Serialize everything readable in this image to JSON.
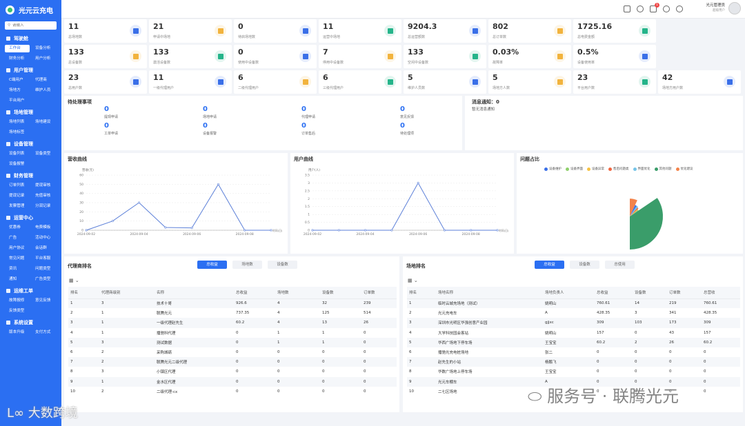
{
  "app": {
    "title": "光元云充电"
  },
  "search": {
    "placeholder": "请输入"
  },
  "sidebar": {
    "groups": [
      {
        "title": "驾驶舱",
        "items": [
          "工作台",
          "设备分析",
          "财务分析",
          "用户分析"
        ]
      },
      {
        "title": "用户管理",
        "items": [
          "C端用户",
          "代理商",
          "场地方",
          "维护人员",
          "平台用户"
        ]
      },
      {
        "title": "场地管理",
        "items": [
          "场地列表",
          "场地建设",
          "场地标签"
        ]
      },
      {
        "title": "设备管理",
        "items": [
          "设备列表",
          "设备类型",
          "设备报警"
        ]
      },
      {
        "title": "财务管理",
        "items": [
          "订单列表",
          "提现审核",
          "提现记录",
          "充值审核",
          "发票管理",
          "分润记录"
        ]
      },
      {
        "title": "运营中心",
        "items": [
          "优惠券",
          "电费模板",
          "广告",
          "活动中心",
          "用户协议",
          "会话群",
          "常见问题",
          "平台客服",
          "资讯",
          "问题类型",
          "通知",
          "广告类型"
        ]
      },
      {
        "title": "运维工单",
        "items": [
          "故障报修",
          "意见反馈",
          "反馈类型"
        ]
      },
      {
        "title": "系统设置",
        "items": [
          "版本升级",
          "支付方式"
        ]
      }
    ]
  },
  "topbar": {
    "notification_count": "1",
    "user_name": "光元管理员",
    "user_role": "超级用户"
  },
  "stats": [
    {
      "value": "11",
      "label": "总场地数",
      "color": "#3a6fe8"
    },
    {
      "value": "21",
      "label": "申请中场地",
      "color": "#f2b33d"
    },
    {
      "value": "0",
      "label": "待启场地数",
      "color": "#3a6fe8"
    },
    {
      "value": "11",
      "label": "运营中场地",
      "color": "#25b48a"
    },
    {
      "value": "9204.3",
      "label": "总运营额数",
      "color": "#3a6fe8"
    },
    {
      "value": "802",
      "label": "总订单数",
      "color": "#f2b33d"
    },
    {
      "value": "1725.16",
      "label": "总电费金额",
      "color": "#25b48a"
    },
    {
      "value": "",
      "label": "",
      "color": "#3a6fe8"
    },
    {
      "value": "133",
      "label": "总设备数",
      "color": "#f2b33d"
    },
    {
      "value": "133",
      "label": "激活设备数",
      "color": "#25b48a"
    },
    {
      "value": "0",
      "label": "使用中设备数",
      "color": "#3a6fe8"
    },
    {
      "value": "7",
      "label": "停用中设备数",
      "color": "#f2b33d"
    },
    {
      "value": "133",
      "label": "空闲中设备数",
      "color": "#25b48a"
    },
    {
      "value": "0.03%",
      "label": "故障率",
      "color": "#f2b33d"
    },
    {
      "value": "0.5%",
      "label": "设备使用率",
      "color": "#3a6fe8"
    },
    {
      "value": "",
      "label": "",
      "color": "#3a6fe8"
    },
    {
      "value": "23",
      "label": "总用户数",
      "color": "#3a6fe8"
    },
    {
      "value": "11",
      "label": "一级代理用户",
      "color": "#3a6fe8"
    },
    {
      "value": "6",
      "label": "二级代理用户",
      "color": "#f2b33d"
    },
    {
      "value": "6",
      "label": "三级代理用户",
      "color": "#25b48a"
    },
    {
      "value": "5",
      "label": "维护人员数",
      "color": "#3a6fe8"
    },
    {
      "value": "5",
      "label": "场地方人数",
      "color": "#f2b33d"
    },
    {
      "value": "23",
      "label": "平台用户数",
      "color": "#25b48a"
    },
    {
      "value": "42",
      "label": "场地方用户数",
      "color": "#3a6fe8"
    }
  ],
  "pending": {
    "title": "待处理事项",
    "items": [
      {
        "value": "0",
        "label": "提现申请"
      },
      {
        "value": "0",
        "label": "场地申请"
      },
      {
        "value": "0",
        "label": "代理申请"
      },
      {
        "value": "0",
        "label": "意见反馈"
      },
      {
        "value": "0",
        "label": "工单申请"
      },
      {
        "value": "0",
        "label": "设备报警"
      },
      {
        "value": "0",
        "label": "订单售后"
      },
      {
        "value": "0",
        "label": "待处理项"
      }
    ]
  },
  "messages": {
    "title": "消息通知：0",
    "text": "暂无消息通知"
  },
  "revenue_chart_title": "营收曲线",
  "user_chart_title": "用户曲线",
  "issue_chart_title": "问题占比",
  "chart_data": [
    {
      "type": "line",
      "title": "营收曲线",
      "ylabel": "营收(元)",
      "xlabel": "时间(日)",
      "x": [
        "2024-09-02",
        "2024-09-03",
        "2024-09-04",
        "2024-09-05",
        "2024-09-06",
        "2024-09-07",
        "2024-09-08",
        "2024-09-09"
      ],
      "xticks": [
        "2024-09-02",
        "2024-09-04",
        "2024-09-06",
        "2024-09-08"
      ],
      "values": [
        0,
        10,
        30,
        3,
        2.5,
        50,
        0,
        0
      ],
      "ylim": [
        0,
        60
      ],
      "yticks": [
        0,
        10,
        20,
        30,
        40,
        50,
        60
      ],
      "color": "#5b7fd8"
    },
    {
      "type": "line",
      "title": "用户曲线",
      "ylabel": "用户(人)",
      "xlabel": "时间(日)",
      "x": [
        "2024-09-02",
        "2024-09-03",
        "2024-09-04",
        "2024-09-05",
        "2024-09-06",
        "2024-09-07",
        "2024-09-08",
        "2024-09-09"
      ],
      "xticks": [
        "2024-09-02",
        "2024-09-04",
        "2024-09-06",
        "2024-09-08"
      ],
      "values": [
        0,
        0,
        0,
        0,
        3,
        0,
        0,
        0
      ],
      "ylim": [
        0,
        3.5
      ],
      "yticks": [
        0,
        0.5,
        1,
        1.5,
        2,
        2.5,
        3,
        3.5
      ],
      "color": "#5b7fd8"
    },
    {
      "type": "pie",
      "title": "问题占比",
      "series": [
        {
          "name": "设备维护",
          "value": 2,
          "color": "#3a6fe8"
        },
        {
          "name": "设备界面",
          "value": 1,
          "color": "#8fd06c"
        },
        {
          "name": "设备异常",
          "value": 1,
          "color": "#f6c244"
        },
        {
          "name": "售后问题类",
          "value": 1.5,
          "color": "#f0663f"
        },
        {
          "name": "界面优化",
          "value": 2,
          "color": "#76c4e8"
        },
        {
          "name": "其他问题",
          "value": 30,
          "color": "#3a9d6a"
        },
        {
          "name": "优化建议",
          "value": 6,
          "color": "#f3834a"
        }
      ]
    }
  ],
  "agent_rank": {
    "title": "代理商排名",
    "tabs": [
      "总收益",
      "场地数",
      "设备数"
    ],
    "columns": [
      "排名",
      "代理商级别",
      "名称",
      "总收益",
      "场地数",
      "设备数",
      "订单数"
    ],
    "rows": [
      [
        "1",
        "3",
        "技术十哥",
        "926.6",
        "4",
        "32",
        "239"
      ],
      [
        "2",
        "1",
        "联腾光元",
        "737.35",
        "4",
        "125",
        "514"
      ],
      [
        "3",
        "1",
        "一级代理赵先生",
        "60.2",
        "4",
        "13",
        "26"
      ],
      [
        "4",
        "1",
        "播驰科代理",
        "0",
        "1",
        "1",
        "0"
      ],
      [
        "5",
        "3",
        "测试数据",
        "0",
        "1",
        "1",
        "0"
      ],
      [
        "6",
        "2",
        "采购城砺",
        "0",
        "0",
        "0",
        "0"
      ],
      [
        "7",
        "2",
        "联腾光元二级代理",
        "0",
        "0",
        "0",
        "0"
      ],
      [
        "8",
        "3",
        "小镇区代理",
        "0",
        "0",
        "0",
        "0"
      ],
      [
        "9",
        "1",
        "金水区代理",
        "0",
        "0",
        "0",
        "0"
      ],
      [
        "10",
        "2",
        "二级代理-cx",
        "0",
        "0",
        "0",
        "0"
      ]
    ]
  },
  "site_rank": {
    "title": "场地排名",
    "tabs": [
      "总收益",
      "设备数",
      "总使用"
    ],
    "columns": [
      "排名",
      "场地名称",
      "场地负责人",
      "总收益",
      "设备数",
      "订单数",
      "总营收"
    ],
    "rows": [
      [
        "1",
        "临时云城充场地（测试）",
        "姚明山",
        "760.61",
        "14",
        "219",
        "760.61"
      ],
      [
        "2",
        "光元充电车",
        "A",
        "428.35",
        "3",
        "341",
        "428.35"
      ],
      [
        "3",
        "深圳市光明区华强创意产业园",
        "gjjxc",
        "309",
        "103",
        "173",
        "309"
      ],
      [
        "4",
        "大学科技园会客站",
        "姚明山",
        "157",
        "0",
        "43",
        "157"
      ],
      [
        "5",
        "华西广场地下停车场",
        "王宝宝",
        "60.2",
        "2",
        "26",
        "60.2"
      ],
      [
        "6",
        "播驰光充电桩场地",
        "张二",
        "0",
        "0",
        "0",
        "0"
      ],
      [
        "7",
        "赵先生的小站",
        "杨鹏飞",
        "0",
        "0",
        "0",
        "0"
      ],
      [
        "8",
        "华数广场地上停车场",
        "王宝宝",
        "0",
        "0",
        "0",
        "0"
      ],
      [
        "9",
        "光元车棚车",
        "A",
        "0",
        "0",
        "0",
        "0"
      ],
      [
        "10",
        "二七区场地",
        "",
        "0",
        "0",
        "0",
        "0"
      ]
    ]
  },
  "watermarks": {
    "left": "大数跨境",
    "right": "服务号 · 联腾光元"
  }
}
